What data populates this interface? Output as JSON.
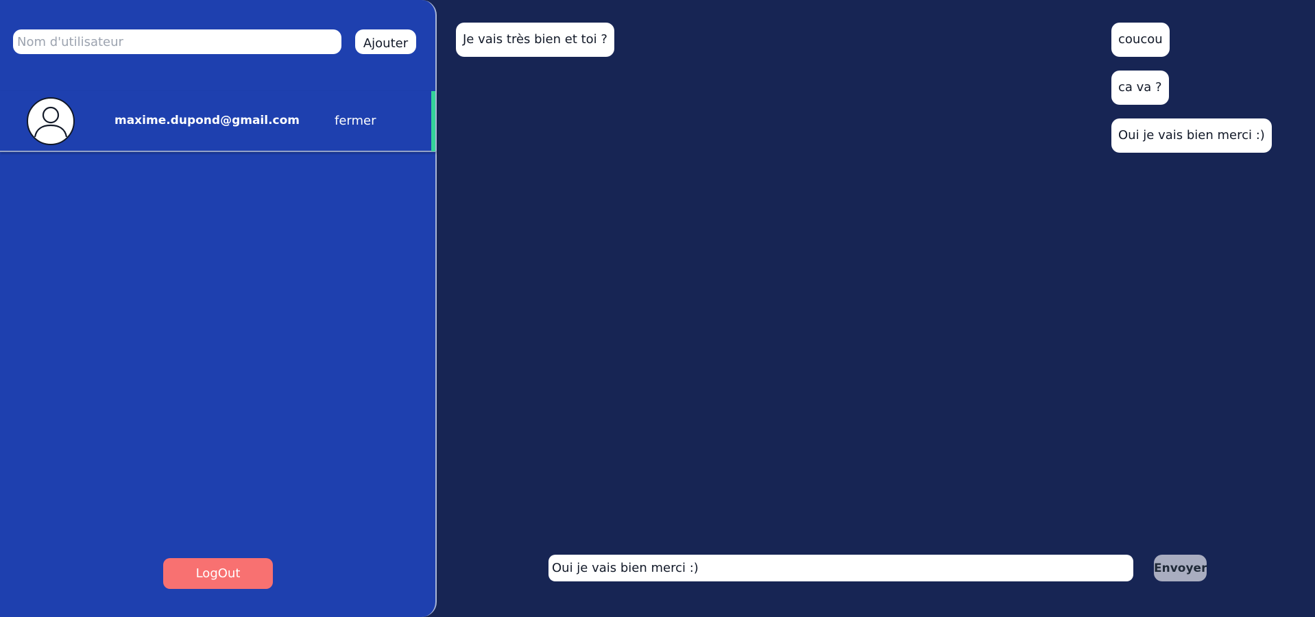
{
  "sidebar": {
    "username_placeholder": "Nom d'utilisateur",
    "add_button_label": "Ajouter",
    "contacts": [
      {
        "email": "maxime.dupond@gmail.com",
        "close_label": "fermer",
        "avatar_icon": "user-avatar-icon",
        "active_accent_color": "#34d399"
      }
    ],
    "logout_label": "LogOut"
  },
  "chat": {
    "messages": [
      {
        "direction": "received",
        "text": "Je vais très bien et toi ?"
      },
      {
        "direction": "sent",
        "text": "coucou"
      },
      {
        "direction": "sent",
        "text": "ca va ?"
      },
      {
        "direction": "sent",
        "text": "Oui je vais bien merci :)"
      }
    ],
    "composer": {
      "value": "Oui je vais bien merci :)",
      "send_label": "Envoyer"
    }
  },
  "colors": {
    "sidebar_bg": "#1e40af",
    "chat_bg": "#172554",
    "logout_bg": "#f87171",
    "send_bg": "#a9adc0",
    "bubble_bg": "#ffffff"
  }
}
